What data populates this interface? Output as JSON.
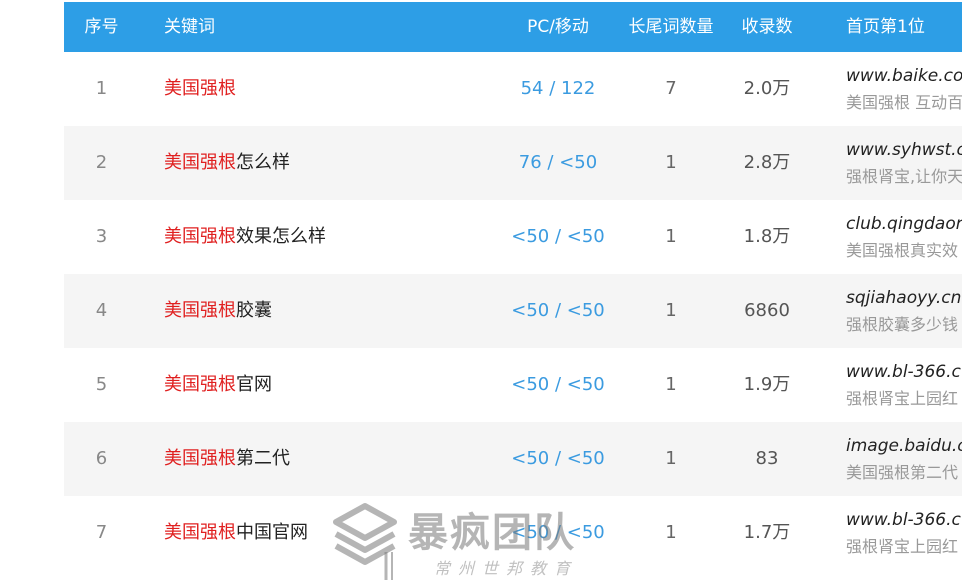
{
  "headers": {
    "index": "序号",
    "keyword": "关键词",
    "pc_mobile": "PC/移动",
    "long_tail": "长尾词数量",
    "indexed": "收录数",
    "first_rank": "首页第1位"
  },
  "rows": [
    {
      "index": "1",
      "kw_highlight": "美国强根",
      "kw_rest": "",
      "pc_mobile": "54 / 122",
      "long_tail": "7",
      "indexed": "2.0万",
      "url": "www.baike.co",
      "desc": "美国强根 互动百"
    },
    {
      "index": "2",
      "kw_highlight": "美国强根",
      "kw_rest": "怎么样",
      "pc_mobile": "76 / <50",
      "long_tail": "1",
      "indexed": "2.8万",
      "url": "www.syhwst.c",
      "desc": "强根肾宝,让你天"
    },
    {
      "index": "3",
      "kw_highlight": "美国强根",
      "kw_rest": "效果怎么样",
      "pc_mobile": "<50 / <50",
      "long_tail": "1",
      "indexed": "1.8万",
      "url": "club.qingdaor",
      "desc": "美国强根真实效"
    },
    {
      "index": "4",
      "kw_highlight": "美国强根",
      "kw_rest": "胶囊",
      "pc_mobile": "<50 / <50",
      "long_tail": "1",
      "indexed": "6860",
      "url": "sqjiahaoyy.cn",
      "desc": "强根胶囊多少钱"
    },
    {
      "index": "5",
      "kw_highlight": "美国强根",
      "kw_rest": "官网",
      "pc_mobile": "<50 / <50",
      "long_tail": "1",
      "indexed": "1.9万",
      "url": "www.bl-366.c",
      "desc": "强根肾宝上园红"
    },
    {
      "index": "6",
      "kw_highlight": "美国强根",
      "kw_rest": "第二代",
      "pc_mobile": "<50 / <50",
      "long_tail": "1",
      "indexed": "83",
      "url": "image.baidu.c",
      "desc": "美国强根第二代"
    },
    {
      "index": "7",
      "kw_highlight": "美国强根",
      "kw_rest": "中国官网",
      "pc_mobile": "<50 / <50",
      "long_tail": "1",
      "indexed": "1.7万",
      "url": "www.bl-366.c",
      "desc": "强根肾宝上园红"
    }
  ],
  "watermark": {
    "title": "暴疯团队",
    "subtitle": "常州世邦教育"
  },
  "colors": {
    "header_bg": "#2d9ee6",
    "keyword_highlight": "#e02020",
    "pc_mobile_text": "#3b9be0",
    "alt_row_bg": "#f5f5f5"
  }
}
